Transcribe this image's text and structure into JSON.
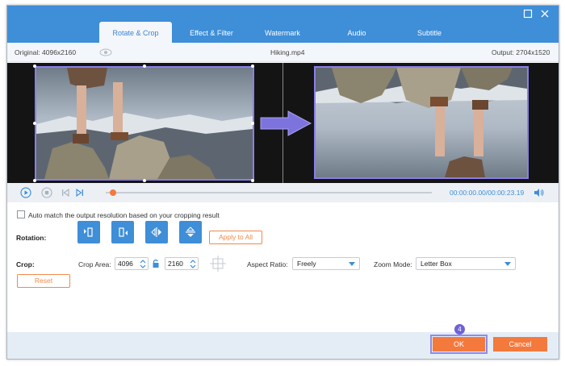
{
  "tabs": [
    {
      "label": "Rotate & Crop",
      "active": true
    },
    {
      "label": "Effect & Filter"
    },
    {
      "label": "Watermark"
    },
    {
      "label": "Audio"
    },
    {
      "label": "Subtitle"
    }
  ],
  "info": {
    "original": "Original: 4096x2160",
    "filename": "Hiking.mp4",
    "output": "Output: 2704x1520"
  },
  "playback": {
    "progress": 0.0,
    "time": "00:00:00.00/00:00:23.19"
  },
  "auto_match": {
    "checked": false,
    "label": "Auto match the output resolution based on your cropping result"
  },
  "rotation": {
    "label": "Rotation:",
    "apply_all": "Apply to All"
  },
  "crop": {
    "label": "Crop:",
    "area_label": "Crop Area:",
    "width": "4096",
    "height": "2160",
    "aspect_label": "Aspect Ratio:",
    "aspect_value": "Freely",
    "zoom_label": "Zoom Mode:",
    "zoom_value": "Letter Box",
    "reset": "Reset"
  },
  "footer": {
    "step": "4",
    "ok": "OK",
    "cancel": "Cancel"
  },
  "colors": {
    "accent": "#3e8ed8",
    "orange": "#f37a3c",
    "highlight": "#8a7fe8"
  }
}
